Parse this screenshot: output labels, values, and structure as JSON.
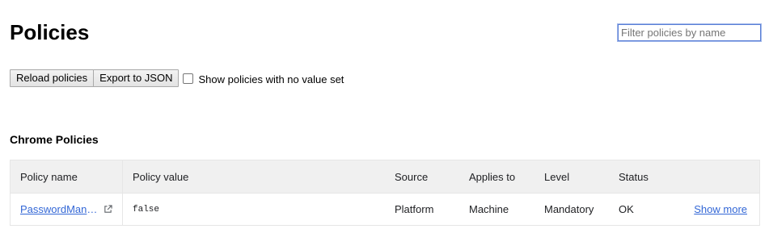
{
  "page": {
    "title": "Policies"
  },
  "filter": {
    "placeholder": "Filter policies by name",
    "value": ""
  },
  "toolbar": {
    "reload_label": "Reload policies",
    "export_label": "Export to JSON",
    "show_unset_label": "Show policies with no value set",
    "show_unset_checked": false
  },
  "section": {
    "title": "Chrome Policies"
  },
  "table": {
    "headers": {
      "name": "Policy name",
      "value": "Policy value",
      "source": "Source",
      "applies": "Applies to",
      "level": "Level",
      "status": "Status"
    },
    "rows": [
      {
        "name": "PasswordManagerEnabled",
        "value": "false",
        "source": "Platform",
        "applies": "Machine",
        "level": "Mandatory",
        "status": "OK",
        "more": "Show more"
      }
    ]
  },
  "colors": {
    "link": "#3367d6",
    "header_bg": "#f0f0f0",
    "focus_border": "#5a7fd6"
  },
  "icons": {
    "external_link": "external-link-icon"
  }
}
